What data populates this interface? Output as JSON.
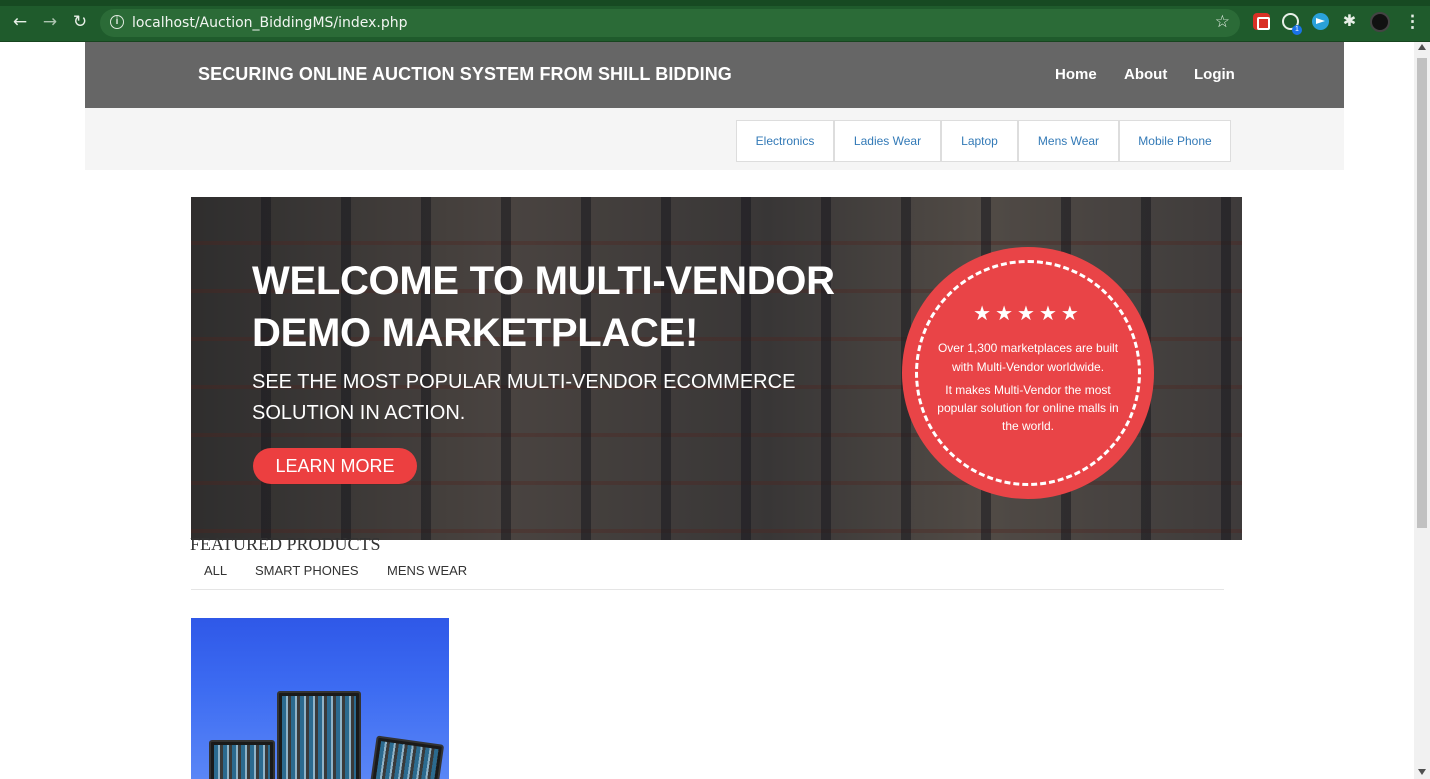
{
  "browser": {
    "url": "localhost/Auction_BiddingMS/index.php",
    "whatsapp_badge": "1",
    "icons": [
      "back-arrow-icon",
      "forward-arrow-icon",
      "reload-icon",
      "info-icon",
      "star-icon",
      "extension-icon",
      "kebab-menu-icon"
    ]
  },
  "site": {
    "title": "SECURING ONLINE AUCTION SYSTEM FROM SHILL BIDDING",
    "nav": {
      "home": "Home",
      "about": "About",
      "login": "Login"
    }
  },
  "categories": [
    "Electronics",
    "Ladies Wear",
    "Laptop",
    "Mens Wear",
    "Mobile Phone"
  ],
  "hero": {
    "title": "WELCOME TO MULTI-VENDOR DEMO MARKETPLACE!",
    "subtitle": "SEE THE MOST POPULAR MULTI-VENDOR ECOMMERCE SOLUTION IN ACTION.",
    "cta": "LEARN MORE",
    "badge": {
      "stars": "★★★★★",
      "line1": "Over 1,300 marketplaces are built with Multi-Vendor worldwide.",
      "line2": "It makes Multi-Vendor the most popular solution for online malls in the world."
    }
  },
  "featured": {
    "title": "FEATURED PRODUCTS",
    "filters": [
      "ALL",
      "SMART PHONES",
      "MENS WEAR"
    ]
  },
  "colors": {
    "chrome": "#1f5b2c",
    "topnav": "#666666",
    "accent_red": "#ec3f40",
    "link_blue": "#337ab7",
    "product_blue": "#3d6cf2"
  }
}
